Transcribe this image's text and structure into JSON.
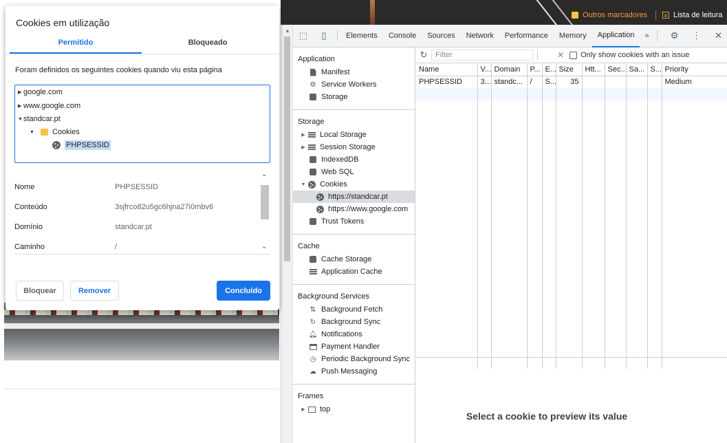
{
  "bookmarks": {
    "other": "Outros marcadores",
    "reading_list": "Lista de leitura"
  },
  "devtools": {
    "tabs": [
      "Elements",
      "Console",
      "Sources",
      "Network",
      "Performance",
      "Memory",
      "Application"
    ],
    "active_tab": "Application",
    "more": "»",
    "sidebar": {
      "application": {
        "title": "Application",
        "items": [
          "Manifest",
          "Service Workers",
          "Storage"
        ]
      },
      "storage": {
        "title": "Storage",
        "local_storage": "Local Storage",
        "session_storage": "Session Storage",
        "indexeddb": "IndexedDB",
        "websql": "Web SQL",
        "cookies": "Cookies",
        "cookie_origins": [
          "https://standcar.pt",
          "https://www.google.com"
        ],
        "trust_tokens": "Trust Tokens"
      },
      "cache": {
        "title": "Cache",
        "items": [
          "Cache Storage",
          "Application Cache"
        ]
      },
      "background_services": {
        "title": "Background Services",
        "items": [
          "Background Fetch",
          "Background Sync",
          "Notifications",
          "Payment Handler",
          "Periodic Background Sync",
          "Push Messaging"
        ]
      },
      "frames": {
        "title": "Frames",
        "top": "top"
      }
    },
    "filter": {
      "placeholder": "Filter",
      "issue_checkbox_label": "Only show cookies with an issue"
    },
    "table": {
      "columns": [
        "Name",
        "V...",
        "Domain",
        "P...",
        "E...",
        "Size",
        "Htt...",
        "Sec...",
        "Sa...",
        "S...",
        "Priority"
      ],
      "rows": [
        [
          "PHPSESSID",
          "3...",
          "standc...",
          "/",
          "S...",
          "35",
          "",
          "",
          "",
          "",
          "Medium"
        ]
      ]
    },
    "preview_message": "Select a cookie to preview its value"
  },
  "dialog": {
    "title": "Cookies em utilização",
    "tabs": [
      "Permitido",
      "Bloqueado"
    ],
    "description": "Foram definidos os seguintes cookies quando viu esta página",
    "tree": {
      "domains": [
        "google.com",
        "www.google.com",
        "standcar.pt"
      ],
      "folder": "Cookies",
      "cookie": "PHPSESSID"
    },
    "details": [
      {
        "key": "Nome",
        "value": "PHPSESSID"
      },
      {
        "key": "Conteúdo",
        "value": "3sjfrco82u5gc6hjna27i0mbv6"
      },
      {
        "key": "Domínio",
        "value": "standcar.pt"
      },
      {
        "key": "Caminho",
        "value": "/"
      }
    ],
    "buttons": {
      "block": "Bloquear",
      "remove": "Remover",
      "done": "Concluído"
    }
  }
}
